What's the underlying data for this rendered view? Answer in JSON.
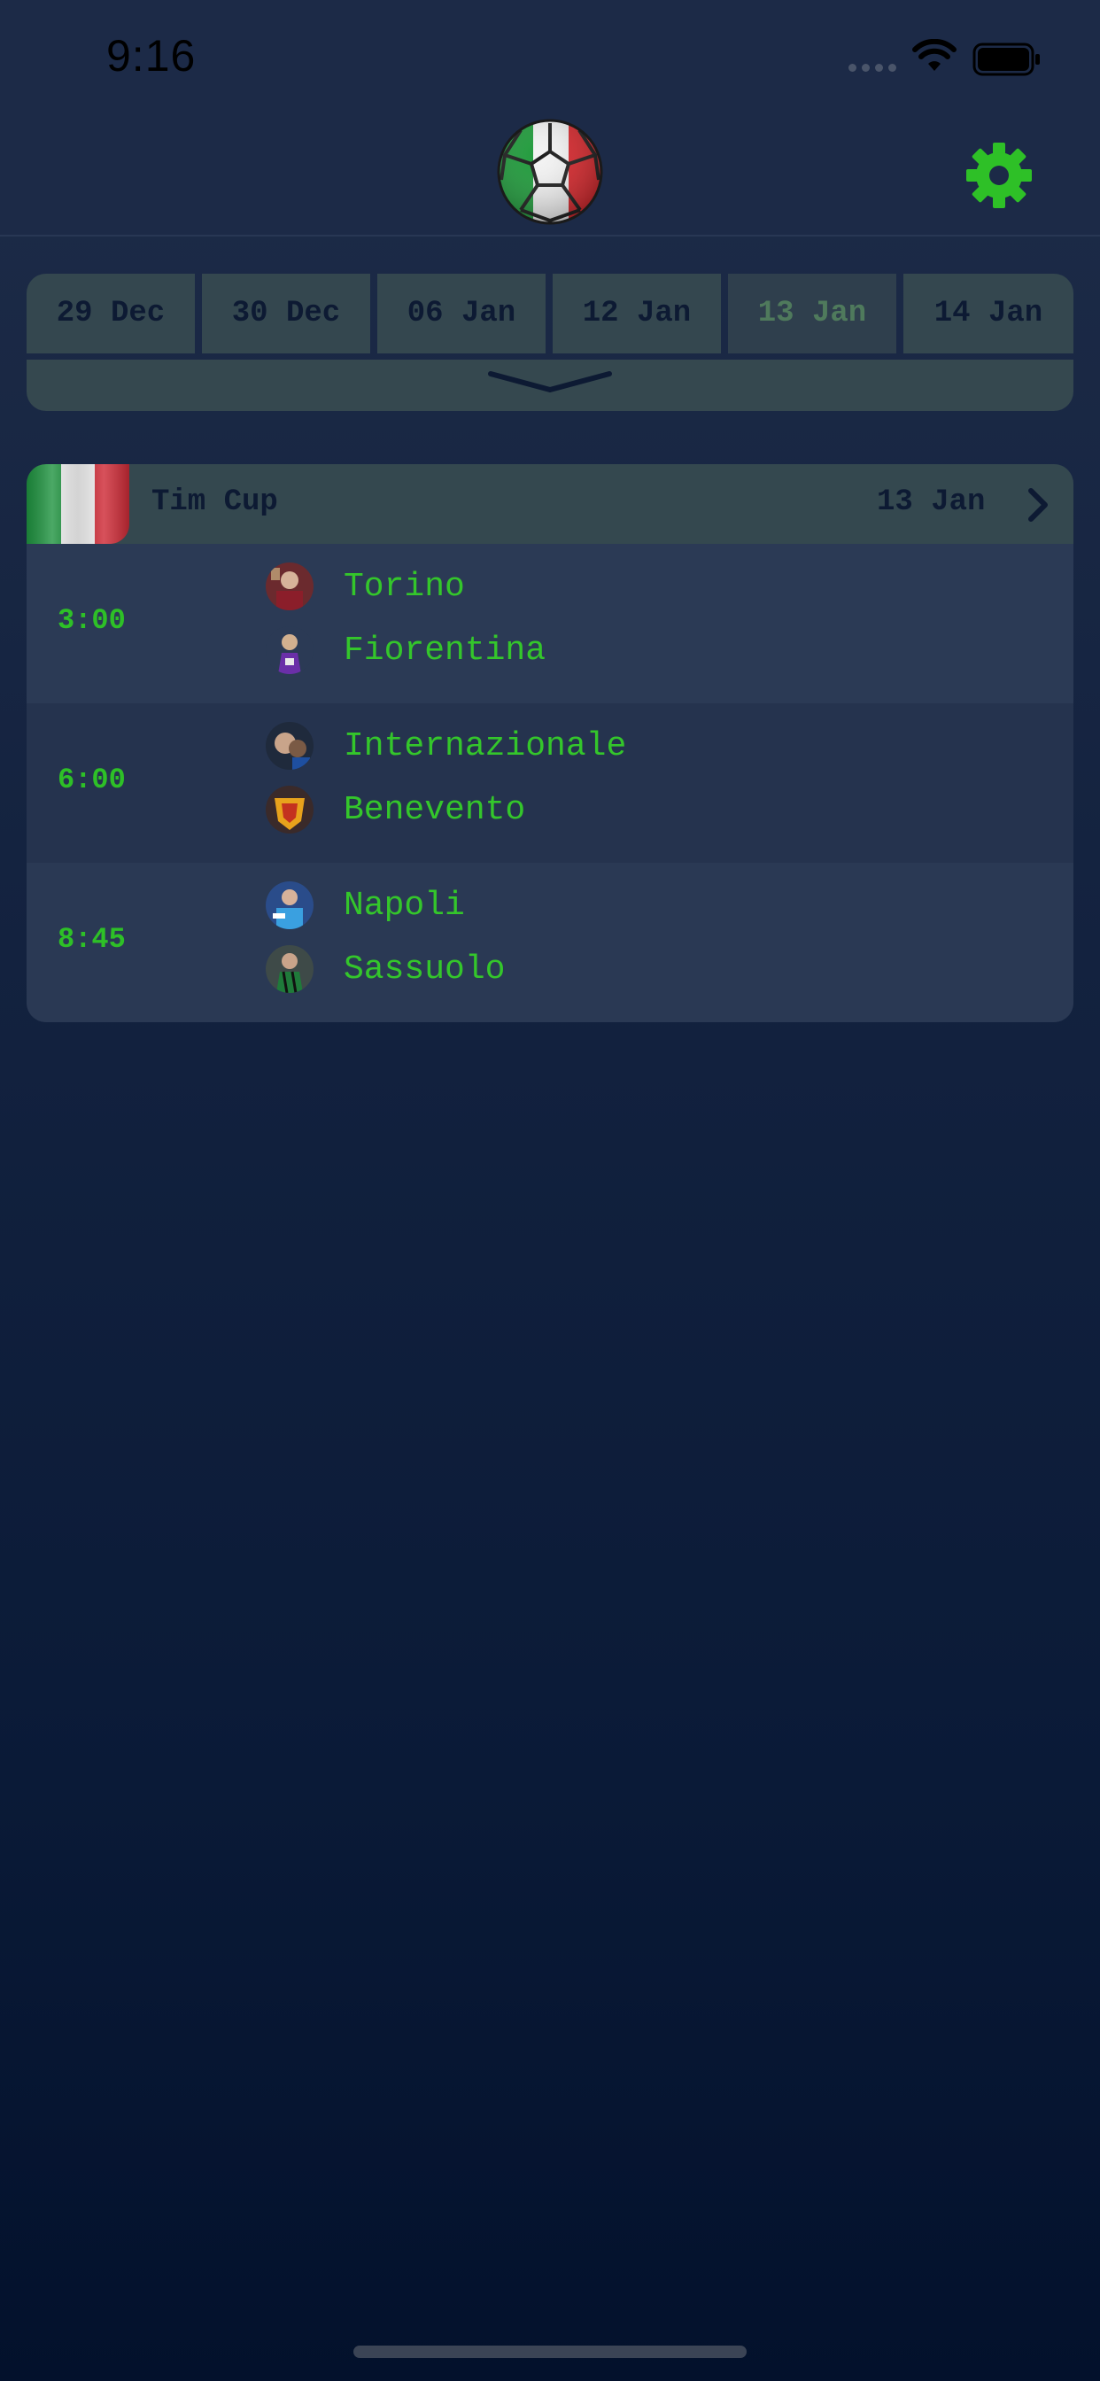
{
  "status_bar": {
    "time": "9:16"
  },
  "header": {
    "logo_icon": "italian-soccer-ball-icon",
    "settings_icon": "gear-icon",
    "accent_color": "#2ec027"
  },
  "dates": {
    "tabs": [
      "29 Dec",
      "30 Dec",
      "06 Jan",
      "12 Jan",
      "13 Jan",
      "14 Jan"
    ],
    "selected": "13 Jan",
    "expand_icon": "chevron-down-icon"
  },
  "league": {
    "name": "Tim Cup",
    "date": "13 Jan",
    "flag_icon": "italy-flag-icon",
    "matches": [
      {
        "time": "3:00",
        "home": "Torino",
        "away": "Fiorentina"
      },
      {
        "time": "6:00",
        "home": "Internazionale",
        "away": "Benevento"
      },
      {
        "time": "8:45",
        "home": "Napoli",
        "away": "Sassuolo"
      }
    ]
  }
}
